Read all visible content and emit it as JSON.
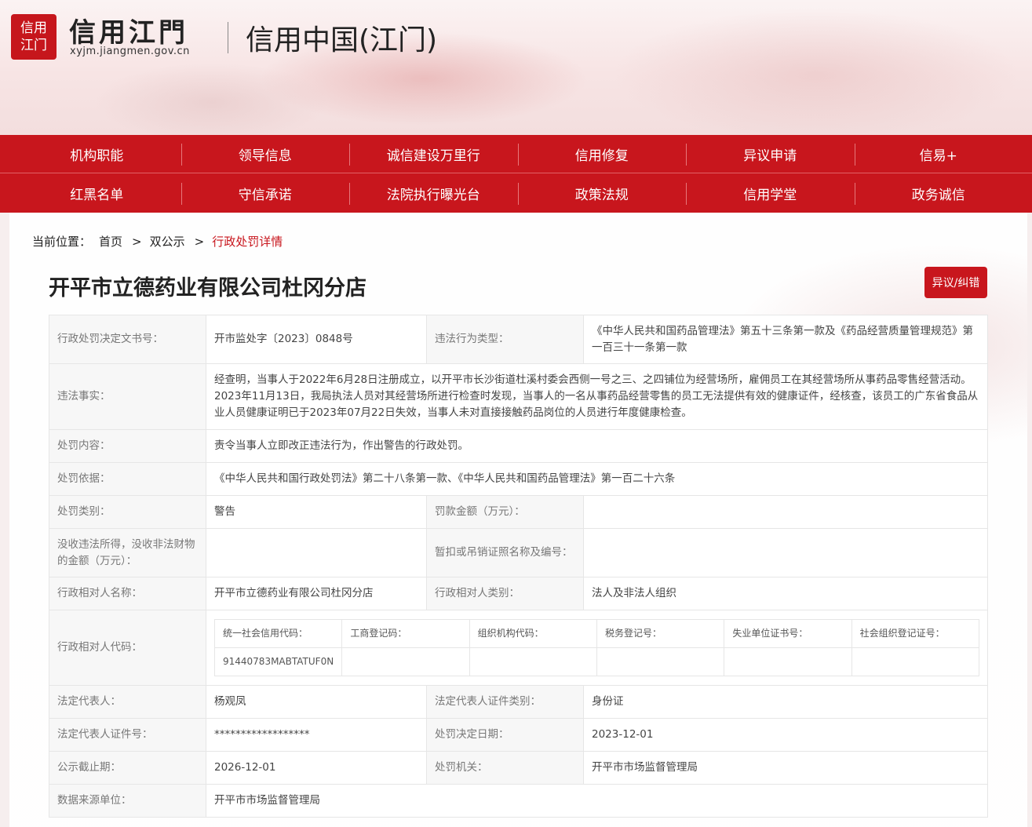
{
  "header": {
    "logo_seal_text": "信用江门",
    "logo_title": "信用江門",
    "domain": "xyjm.jiangmen.gov.cn",
    "site_name": "信用中国(江门)"
  },
  "nav": {
    "row1": [
      "机构职能",
      "领导信息",
      "诚信建设万里行",
      "信用修复",
      "异议申请",
      "信易+"
    ],
    "row2": [
      "红黑名单",
      "守信承诺",
      "法院执行曝光台",
      "政策法规",
      "信用学堂",
      "政务诚信"
    ]
  },
  "breadcrumb": {
    "label": "当前位置：",
    "home": "首页",
    "section": "双公示",
    "current": "行政处罚详情",
    "sep": ">"
  },
  "title": "开平市立德药业有限公司杜冈分店",
  "objection_button": "异议/纠错",
  "fields": {
    "decision_no_label": "行政处罚决定文书号：",
    "decision_no": "开市监处字〔2023〕0848号",
    "violation_type_label": "违法行为类型：",
    "violation_type": "《中华人民共和国药品管理法》第五十三条第一款及《药品经营质量管理规范》第一百三十一条第一款",
    "facts_label": "违法事实：",
    "facts": "经查明，当事人于2022年6月28日注册成立，以开平市长沙街道杜溪村委会西侧一号之三、之四铺位为经营场所，雇佣员工在其经营场所从事药品零售经营活动。2023年11月13日，我局执法人员对其经营场所进行检查时发现，当事人的一名从事药品经营零售的员工无法提供有效的健康证件，经核查，该员工的广东省食品从业人员健康证明已于2023年07月22日失效，当事人未对直接接触药品岗位的人员进行年度健康检查。",
    "penalty_content_label": "处罚内容：",
    "penalty_content": "责令当事人立即改正违法行为，作出警告的行政处罚。",
    "basis_label": "处罚依据：",
    "basis": "《中华人民共和国行政处罚法》第二十八条第一款、《中华人民共和国药品管理法》第一百二十六条",
    "category_label": "处罚类别：",
    "category": "警告",
    "fine_label": "罚款金额（万元）：",
    "fine": "",
    "confiscation_label": "没收违法所得，没收非法财物的金额（万元）：",
    "confiscation": "",
    "license_label": "暂扣或吊销证照名称及编号：",
    "license": "",
    "party_name_label": "行政相对人名称：",
    "party_name": "开平市立德药业有限公司杜冈分店",
    "party_type_label": "行政相对人类别：",
    "party_type": "法人及非法人组织",
    "party_code_label": "行政相对人代码：",
    "codes_header": [
      "统一社会信用代码：",
      "工商登记码：",
      "组织机构代码：",
      "税务登记号：",
      "失业单位证书号：",
      "社会组织登记证号："
    ],
    "codes_values": [
      "91440783MABTATUF0N",
      "",
      "",
      "",
      "",
      ""
    ],
    "legal_rep_label": "法定代表人：",
    "legal_rep": "杨观凤",
    "legal_rep_id_type_label": "法定代表人证件类别：",
    "legal_rep_id_type": "身份证",
    "legal_rep_id_no_label": "法定代表人证件号：",
    "legal_rep_id_no": "******************",
    "decision_date_label": "处罚决定日期：",
    "decision_date": "2023-12-01",
    "publish_end_label": "公示截止期：",
    "publish_end": "2026-12-01",
    "authority_label": "处罚机关：",
    "authority": "开平市市场监督管理局",
    "data_source_label": "数据来源单位：",
    "data_source": "开平市市场监督管理局"
  }
}
